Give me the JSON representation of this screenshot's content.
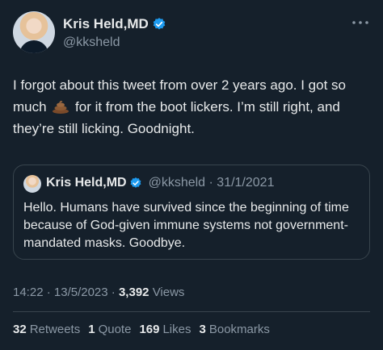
{
  "author": {
    "display_name": "Kris Held,MD",
    "handle": "@kksheld",
    "verified": true
  },
  "tweet": {
    "text_part1": "I forgot about this tweet from over 2 years ago. I got so much ",
    "emoji": "pile-of-poo",
    "text_part2": " for it from the boot lickers. I’m still right, and they’re still licking. Goodnight.",
    "time": "14:22",
    "date": "13/5/2023",
    "views_count": "3,392",
    "views_label": "Views"
  },
  "quoted_tweet": {
    "display_name": "Kris Held,MD",
    "handle_date": "@kksheld · 31/1/2021",
    "text": "Hello. Humans have survived since the beginning of time because of God-given immune systems not government-mandated masks. Goodbye."
  },
  "stats": [
    {
      "count": "32",
      "label": "Retweets"
    },
    {
      "count": "1",
      "label": "Quote"
    },
    {
      "count": "169",
      "label": "Likes"
    },
    {
      "count": "3",
      "label": "Bookmarks"
    }
  ],
  "colors": {
    "background": "#15202b",
    "text": "#e7e9ea",
    "secondary": "#8b98a5",
    "border": "#38444d",
    "verified": "#1d9bf0"
  }
}
